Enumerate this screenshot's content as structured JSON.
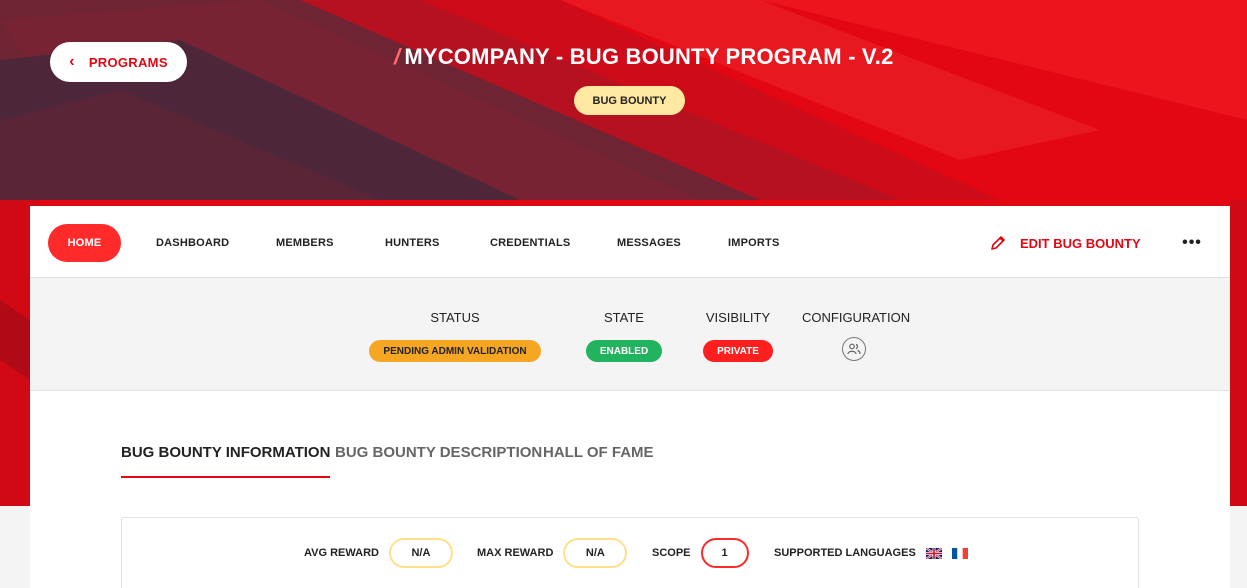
{
  "header": {
    "back_label": "PROGRAMS",
    "title_slash": "/",
    "title": "MYCOMPANY - BUG BOUNTY PROGRAM - V.2",
    "type_badge": "BUG BOUNTY"
  },
  "nav": {
    "items": [
      {
        "label": "HOME",
        "active": true
      },
      {
        "label": "DASHBOARD"
      },
      {
        "label": "MEMBERS"
      },
      {
        "label": "HUNTERS"
      },
      {
        "label": "CREDENTIALS"
      },
      {
        "label": "MESSAGES"
      },
      {
        "label": "IMPORTS"
      }
    ],
    "edit_label": "EDIT BUG BOUNTY",
    "more_label": "•••"
  },
  "status": {
    "status_label": "STATUS",
    "status_value": "PENDING ADMIN VALIDATION",
    "state_label": "STATE",
    "state_value": "ENABLED",
    "visibility_label": "VISIBILITY",
    "visibility_value": "PRIVATE",
    "configuration_label": "CONFIGURATION",
    "configuration_icon": "users-icon"
  },
  "tabs": [
    {
      "label": "BUG BOUNTY INFORMATION",
      "active": true
    },
    {
      "label": "BUG BOUNTY DESCRIPTION"
    },
    {
      "label": "HALL OF FAME"
    }
  ],
  "info": {
    "avg_reward_label": "AVG REWARD",
    "avg_reward_value": "N/A",
    "max_reward_label": "MAX REWARD",
    "max_reward_value": "N/A",
    "scope_label": "SCOPE",
    "scope_value": "1",
    "languages_label": "SUPPORTED LANGUAGES",
    "languages": [
      "uk-flag-icon",
      "fr-flag-icon"
    ]
  },
  "colors": {
    "brand_red": "#e30613",
    "pending": "#f5a623",
    "enabled": "#22b35e",
    "private": "#ff1f1f"
  }
}
